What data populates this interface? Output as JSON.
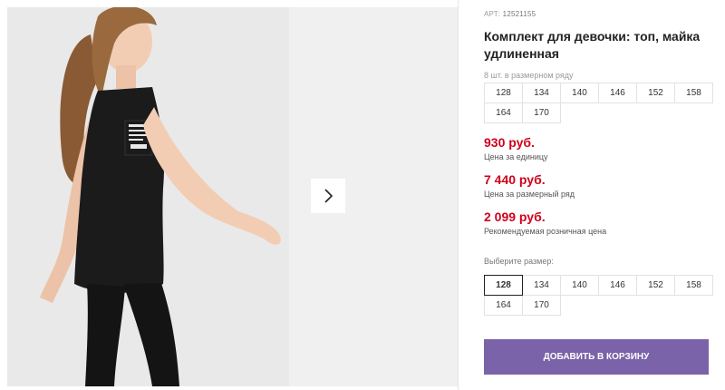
{
  "product": {
    "article_prefix": "АРТ:",
    "article_number": "12521155",
    "title": "Комплект для девочки: топ, майка удлиненная",
    "shirt_print": "DON'T LOOK BACK YOU'RE NOT GOING THAT WAY",
    "pack_label": "8 шт. в размерном ряду",
    "pack_sizes": [
      "128",
      "134",
      "140",
      "146",
      "152",
      "158",
      "164",
      "170"
    ],
    "unit_price": "930 руб.",
    "unit_price_note": "Цена за единицу",
    "pack_price": "7 440 руб.",
    "pack_price_note": "Цена за размерный ряд",
    "retail_price": "2 099 руб.",
    "retail_price_note": "Рекомендуемая розничная цена",
    "select_label": "Выберите размер:",
    "select_sizes": [
      "128",
      "134",
      "140",
      "146",
      "152",
      "158",
      "164",
      "170"
    ],
    "selected_size": "128",
    "add_to_cart": "ДОБАВИТЬ В КОРЗИНУ"
  },
  "gallery": {
    "next_icon": "chevron-right-icon"
  },
  "colors": {
    "price": "#d0021b",
    "button": "#7a63a8",
    "photo_background": "#e9e9e9"
  }
}
